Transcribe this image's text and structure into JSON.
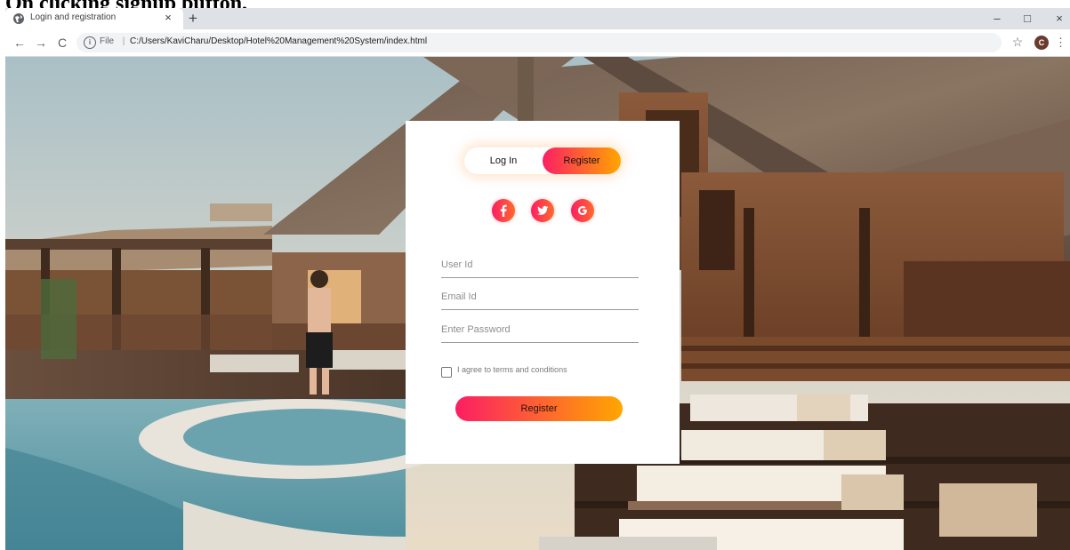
{
  "caption": "On clicking signup button,",
  "browser": {
    "tab_title": "Login and registration",
    "tab_close": "×",
    "new_tab": "+",
    "window_controls": [
      "–",
      "□",
      "×"
    ],
    "nav": {
      "back": "←",
      "forward": "→",
      "reload": "C"
    },
    "address": {
      "scheme_label": "File",
      "separator": "|",
      "url": "C:/Users/KaviCharu/Desktop/Hotel%20Management%20System/index.html"
    },
    "profile_initial": "C",
    "icons": {
      "tab": "globe-icon",
      "info": "info-icon",
      "star": "bookmark-star-icon",
      "menu": "kebab-menu-icon"
    }
  },
  "form": {
    "toggle": {
      "login_label": "Log In",
      "register_label": "Register",
      "active": "Register"
    },
    "social": [
      "facebook-icon",
      "twitter-icon",
      "google-icon"
    ],
    "fields": {
      "user_id_placeholder": "User Id",
      "email_placeholder": "Email Id",
      "password_placeholder": "Enter Password"
    },
    "terms_label": "I agree to terms and conditions",
    "terms_checked": false,
    "submit_label": "Register"
  },
  "colors": {
    "gradient_start": "#fc1e63",
    "gradient_end": "#ffa600",
    "card_background": "#ffffff"
  }
}
